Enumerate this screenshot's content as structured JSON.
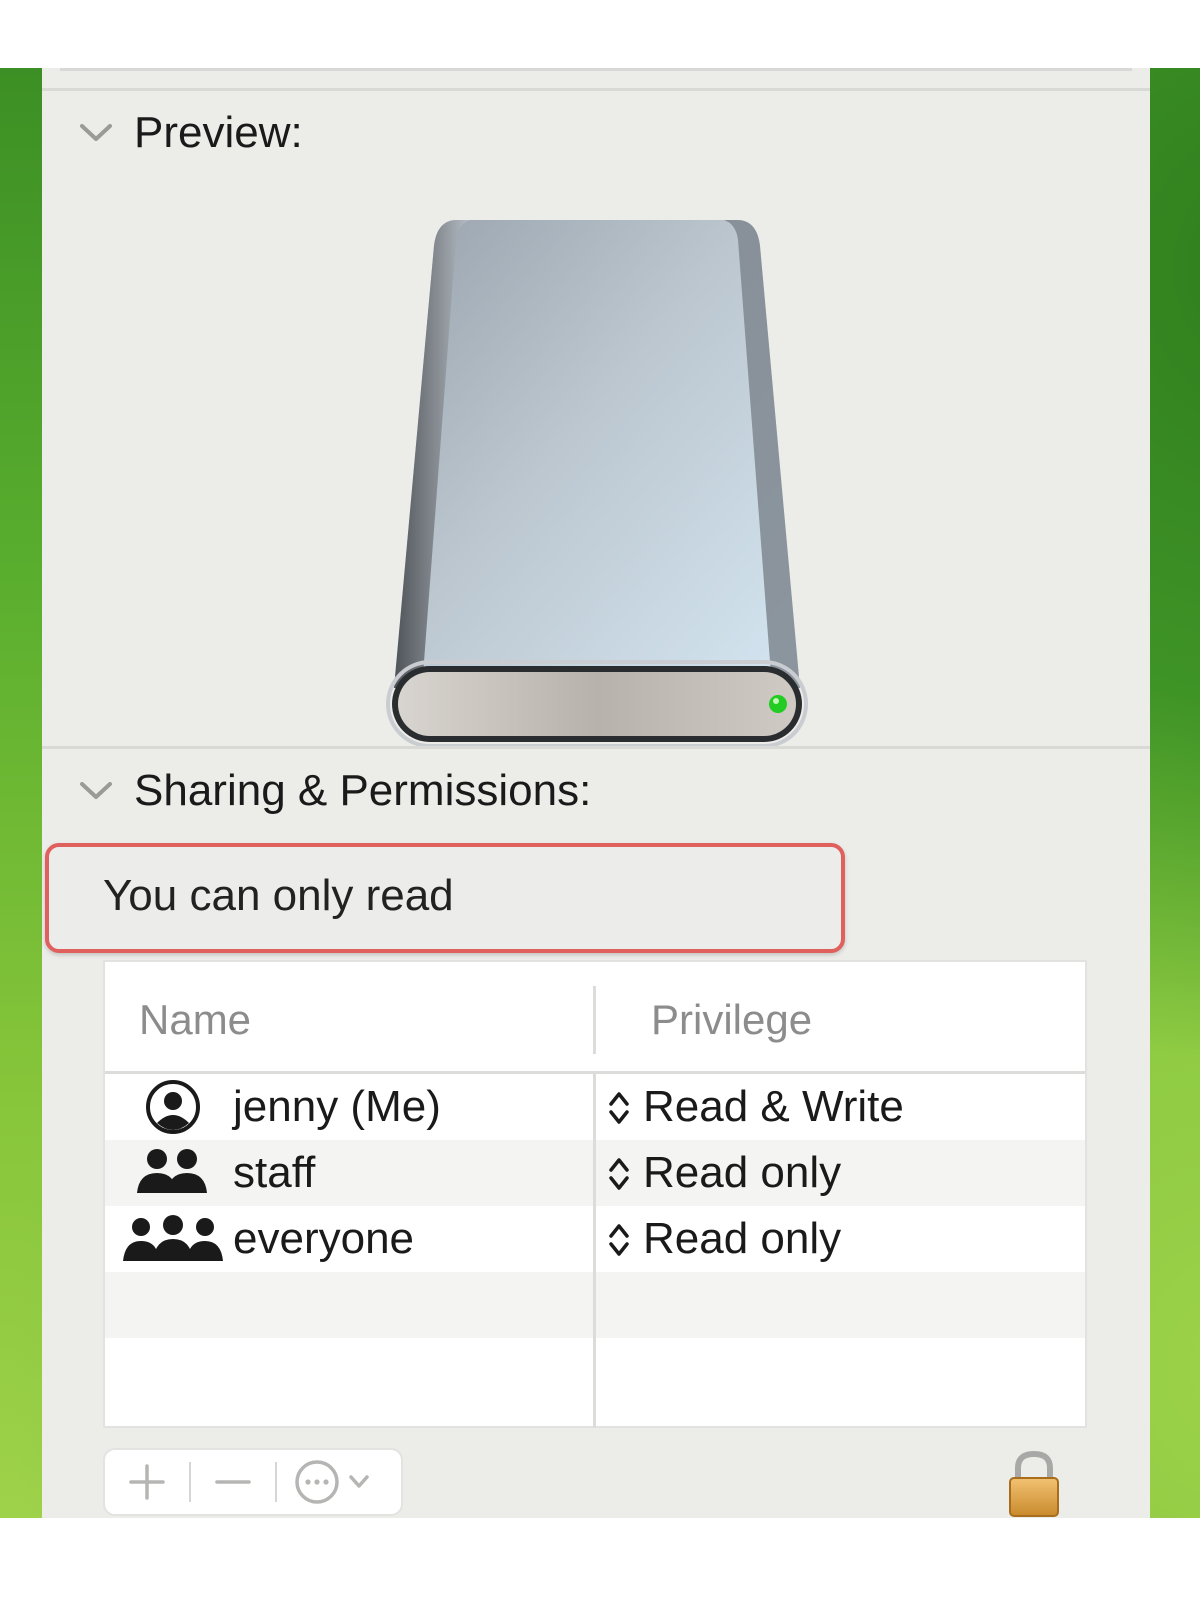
{
  "preview": {
    "title": "Preview:",
    "icon": "external-drive-icon"
  },
  "sharing": {
    "title": "Sharing & Permissions:",
    "notice": "You can only read",
    "notice_highlight_color": "#e0605e",
    "columns": {
      "name": "Name",
      "privilege": "Privilege"
    },
    "rows": [
      {
        "name": "jenny (Me)",
        "privilege": "Read & Write",
        "icon": "user-icon"
      },
      {
        "name": "staff",
        "privilege": "Read only",
        "icon": "group-icon"
      },
      {
        "name": "everyone",
        "privilege": "Read only",
        "icon": "everyone-icon"
      }
    ]
  },
  "toolbar": {
    "add_icon": "plus-icon",
    "remove_icon": "minus-icon",
    "action_icon": "ellipsis-circle-icon",
    "lock_icon": "lock-icon"
  },
  "colors": {
    "panel": "#ecece9",
    "wallpaper": "#5aae2e",
    "led": "#22cc22"
  }
}
